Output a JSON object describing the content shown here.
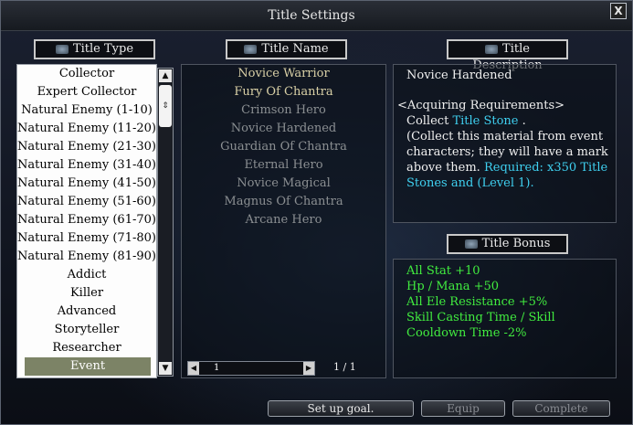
{
  "window": {
    "title": "Title Settings",
    "close_label": "X"
  },
  "headers": {
    "type": "Title Type",
    "name": "Title Name",
    "description": "Title Description",
    "bonus": "Title Bonus"
  },
  "title_types": [
    "Collector",
    "Expert Collector",
    "Natural Enemy (1-10)",
    "Natural Enemy (11-20)",
    "Natural Enemy (21-30)",
    "Natural Enemy (31-40)",
    "Natural Enemy (41-50)",
    "Natural Enemy (51-60)",
    "Natural Enemy (61-70)",
    "Natural Enemy (71-80)",
    "Natural Enemy (81-90)",
    "Addict",
    "Killer",
    "Advanced",
    "Storyteller",
    "Researcher",
    "Event"
  ],
  "selected_type": "Event",
  "title_names": [
    {
      "label": "Novice Warrior",
      "state": "owned"
    },
    {
      "label": "Fury Of Chantra",
      "state": "owned"
    },
    {
      "label": "Crimson Hero",
      "state": "locked"
    },
    {
      "label": "Novice Hardened",
      "state": "selected"
    },
    {
      "label": "Guardian Of Chantra",
      "state": "locked"
    },
    {
      "label": "Eternal Hero",
      "state": "locked"
    },
    {
      "label": "Novice Magical",
      "state": "locked"
    },
    {
      "label": "Magnus Of Chantra",
      "state": "locked"
    },
    {
      "label": "Arcane Hero",
      "state": "locked"
    }
  ],
  "pager": {
    "value": "1",
    "pages": "1 / 1"
  },
  "description": {
    "title": "Novice Hardened",
    "req_header": "<Acquiring Requirements>",
    "collect_prefix": "Collect",
    "collect_item": "Title Stone",
    "collect_suffix": ".",
    "note": "(Collect this material from event characters; they will have a mark above them.",
    "required": "Required: x350 Title Stones and (Level 1)."
  },
  "bonus": [
    "All Stat +10",
    "Hp / Mana +50",
    "All Ele Resistance +5%",
    "Skill Casting Time / Skill",
    "Cooldown Time -2%"
  ],
  "buttons": {
    "goal": "Set up goal.",
    "equip": "Equip",
    "complete": "Complete"
  },
  "colors": {
    "cyan": "#3fd0f0",
    "bonus_green": "#41ec3f",
    "owned": "#d9d0a6",
    "locked": "#8b8f92"
  }
}
